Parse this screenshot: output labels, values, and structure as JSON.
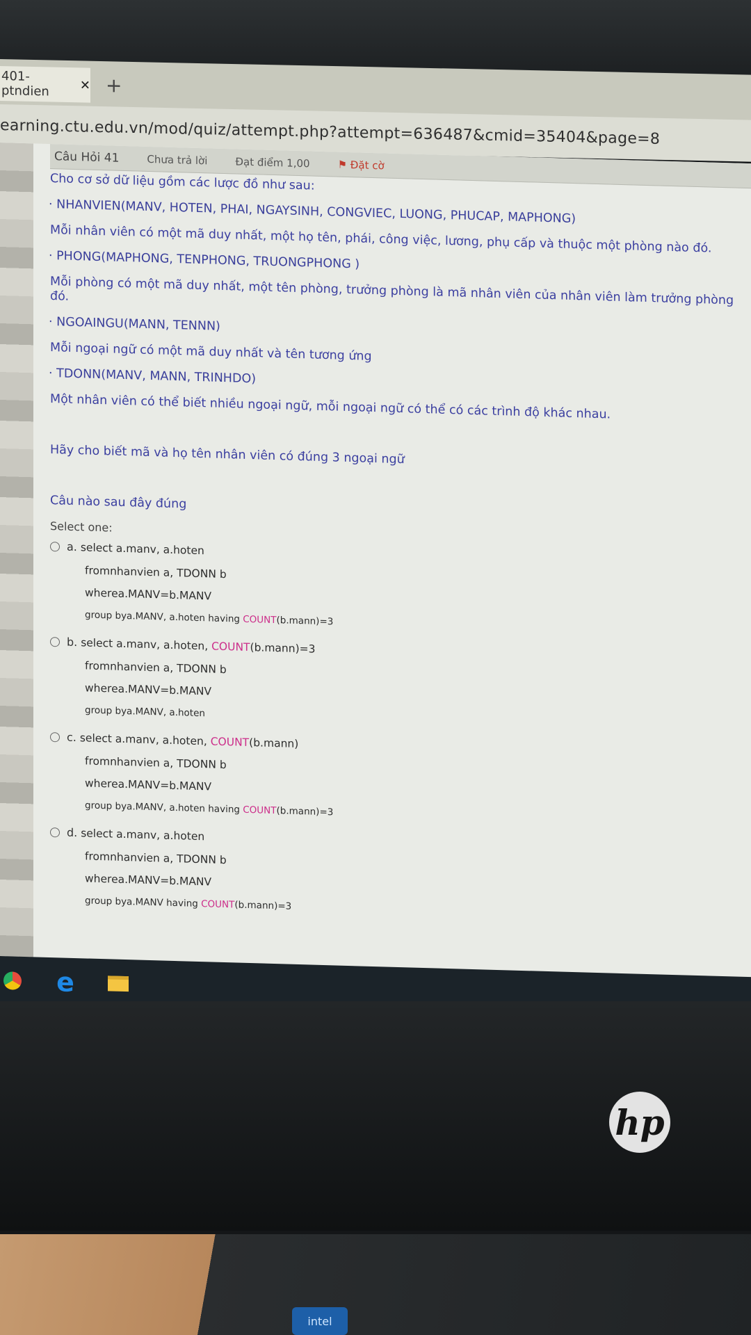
{
  "browser": {
    "tab_title": "401- ptndien",
    "close_glyph": "✕",
    "newtab_glyph": "+",
    "url": "earning.ctu.edu.vn/mod/quiz/attempt.php?attempt=636487&cmid=35404&page=8"
  },
  "question_header": {
    "number": "Câu Hỏi 41",
    "status": "Chưa trả lời",
    "grade": "Đạt điểm 1,00",
    "flag_label": "Đặt cờ"
  },
  "question": {
    "intro": "Cho cơ sở dữ liệu gồm các lược đồ như sau:",
    "schema1": "· NHANVIEN(MANV, HOTEN, PHAI, NGAYSINH, CONGVIEC, LUONG, PHUCAP, MAPHONG)",
    "desc1": "Mỗi nhân viên có một mã duy nhất, một họ tên, phái, công việc, lương, phụ cấp và thuộc một phòng nào đó.",
    "schema2": "· PHONG(MAPHONG, TENPHONG, TRUONGPHONG )",
    "desc2": "Mỗi phòng có một mã duy nhất, một tên phòng, trưởng phòng là mã nhân viên của nhân viên làm trưởng phòng đó.",
    "schema3": "· NGOAINGU(MANN, TENNN)",
    "desc3": "Mỗi ngoại ngữ có một mã duy nhất và tên tương ứng",
    "schema4": "· TDONN(MANV, MANN, TRINHDO)",
    "desc4": "Một nhân viên có thể biết nhiều ngoại ngữ, mỗi ngoại ngữ có thể có các trình độ khác nhau.",
    "task": "Hãy cho biết mã và họ tên nhân viên có đúng 3 ngoại ngữ",
    "prompt": "Câu nào sau đây đúng",
    "select_one": "Select one:"
  },
  "options": {
    "a": {
      "letter": "a.",
      "l1": "select a.manv, a.hoten",
      "l2": "fromnhanvien a, TDONN b",
      "l3": "wherea.MANV=b.MANV",
      "l4_pre": "group bya.MANV, a.hoten having ",
      "l4_kw": "COUNT",
      "l4_post": "(b.mann)=3"
    },
    "b": {
      "letter": "b.",
      "l1_pre": "select a.manv, a.hoten, ",
      "l1_kw": "COUNT",
      "l1_post": "(b.mann)=3",
      "l2": "fromnhanvien a, TDONN b",
      "l3": "wherea.MANV=b.MANV",
      "l4": "group bya.MANV, a.hoten"
    },
    "c": {
      "letter": "c.",
      "l1_pre": "select a.manv, a.hoten, ",
      "l1_kw": "COUNT",
      "l1_post": "(b.mann)",
      "l2": "fromnhanvien a, TDONN b",
      "l3": "wherea.MANV=b.MANV",
      "l4_pre": "group bya.MANV, a.hoten having ",
      "l4_kw": "COUNT",
      "l4_post": "(b.mann)=3"
    },
    "d": {
      "letter": "d.",
      "l1": "select a.manv, a.hoten",
      "l2": "fromnhanvien a, TDONN b",
      "l3": "wherea.MANV=b.MANV",
      "l4_pre": "group bya.MANV having ",
      "l4_kw": "COUNT",
      "l4_post": "(b.mann)=3"
    }
  },
  "taskbar": {
    "icons": [
      "chrome-icon",
      "edge-icon",
      "file-explorer-icon"
    ],
    "edge_glyph": "e"
  },
  "hardware": {
    "hp_logo": "hp",
    "intel_label": "intel"
  }
}
